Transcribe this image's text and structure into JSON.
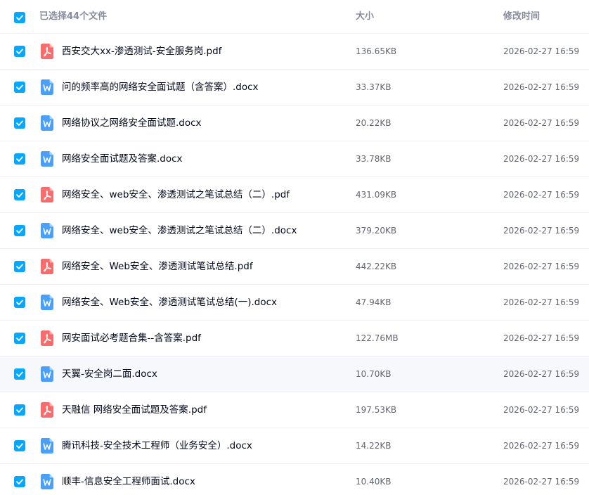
{
  "colors": {
    "accent": "#06a7ff",
    "pdf_icon": "#f76d6d",
    "word_icon": "#4aa0f8",
    "header_text": "#878c9c",
    "meta_text": "#636670"
  },
  "header": {
    "selected_label": "已选择44个文件",
    "size_label": "大小",
    "time_label": "修改时间",
    "all_checked": true
  },
  "files": [
    {
      "name": "西安交大xx-渗透测试-安全服务岗.pdf",
      "type": "pdf",
      "icon": "pdf-icon",
      "size": "136.65KB",
      "modified": "2026-02-27 16:59",
      "checked": true
    },
    {
      "name": "问的频率高的网络安全面试题（含答案）.docx",
      "type": "docx",
      "icon": "word-icon",
      "size": "33.37KB",
      "modified": "2026-02-27 16:59",
      "checked": true
    },
    {
      "name": "网络协议之网络安全面试题.docx",
      "type": "docx",
      "icon": "word-icon",
      "size": "20.22KB",
      "modified": "2026-02-27 16:59",
      "checked": true
    },
    {
      "name": "网络安全面试题及答案.docx",
      "type": "docx",
      "icon": "word-icon",
      "size": "33.78KB",
      "modified": "2026-02-27 16:59",
      "checked": true
    },
    {
      "name": "网络安全、web安全、渗透测试之笔试总结（二）.pdf",
      "type": "pdf",
      "icon": "pdf-icon",
      "size": "431.09KB",
      "modified": "2026-02-27 16:59",
      "checked": true
    },
    {
      "name": "网络安全、web安全、渗透测试之笔试总结（二）.docx",
      "type": "docx",
      "icon": "word-icon",
      "size": "379.20KB",
      "modified": "2026-02-27 16:59",
      "checked": true
    },
    {
      "name": "网络安全、Web安全、渗透测试笔试总结.pdf",
      "type": "pdf",
      "icon": "pdf-icon",
      "size": "442.22KB",
      "modified": "2026-02-27 16:59",
      "checked": true
    },
    {
      "name": "网络安全、Web安全、渗透测试笔试总结(一).docx",
      "type": "docx",
      "icon": "word-icon",
      "size": "47.94KB",
      "modified": "2026-02-27 16:59",
      "checked": true
    },
    {
      "name": "网安面试必考题合集--含答案.pdf",
      "type": "pdf",
      "icon": "pdf-icon",
      "size": "122.76MB",
      "modified": "2026-02-27 16:59",
      "checked": true
    },
    {
      "name": "天翼-安全岗二面.docx",
      "type": "docx",
      "icon": "word-icon",
      "size": "10.70KB",
      "modified": "2026-02-27 16:59",
      "checked": true
    },
    {
      "name": "天融信 网络安全面试题及答案.pdf",
      "type": "pdf",
      "icon": "pdf-icon",
      "size": "197.53KB",
      "modified": "2026-02-27 16:59",
      "checked": true
    },
    {
      "name": "腾讯科技-安全技术工程师（业务安全）.docx",
      "type": "docx",
      "icon": "word-icon",
      "size": "14.22KB",
      "modified": "2026-02-27 16:59",
      "checked": true
    },
    {
      "name": "顺丰-信息安全工程师面试.docx",
      "type": "docx",
      "icon": "word-icon",
      "size": "10.40KB",
      "modified": "2026-02-27 16:59",
      "checked": true
    }
  ]
}
